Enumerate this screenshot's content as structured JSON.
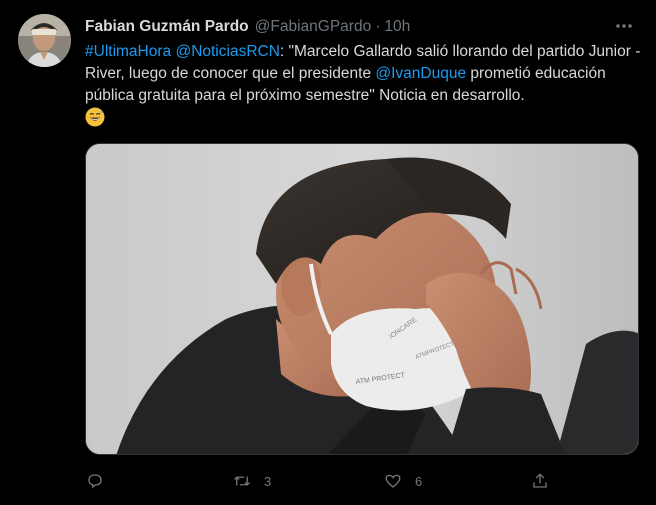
{
  "tweet": {
    "author": {
      "display_name": "Fabian Guzmán Pardo",
      "handle": "@FabianGPardo",
      "separator": "·",
      "time": "10h"
    },
    "text": {
      "hashtag": "#UltimaHora",
      "mention_1": "@NoticiasRCN",
      "part_1": ": \"Marcelo Gallardo salió llorando del partido Junior - River, luego de conocer que el presidente ",
      "mention_2": "@IvanDuque",
      "part_2": " prometió educación pública gratuita para el próximo semestre\" Noticia en desarrollo.",
      "emoji": "grinning-face-with-sweat-emoji"
    },
    "media": {
      "type": "photo",
      "mask_texts": [
        "ATMPROTECT",
        "IONCARE",
        "ATM PROTECT"
      ]
    },
    "actions": {
      "reply_count": "",
      "retweet_count": "3",
      "like_count": "6"
    }
  },
  "colors": {
    "background": "#000000",
    "text": "#d9d9d9",
    "secondary": "#6e767d",
    "link": "#1d9bf0"
  },
  "icons": [
    "more-icon",
    "reply-icon",
    "retweet-icon",
    "like-icon",
    "share-icon"
  ]
}
